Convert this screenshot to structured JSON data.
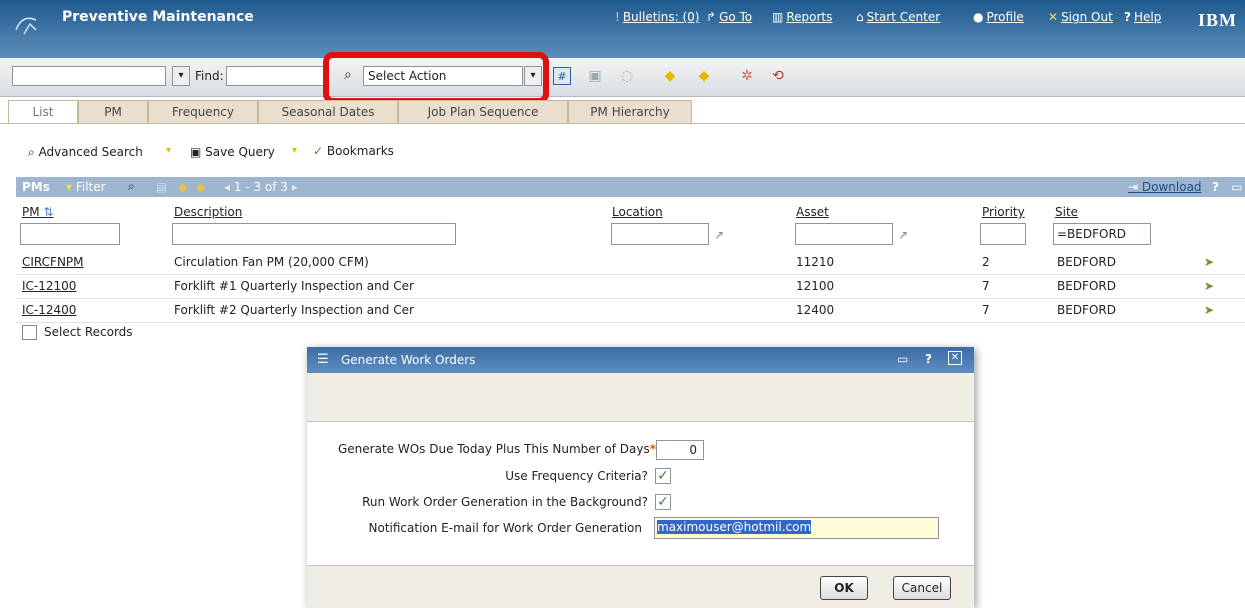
{
  "header": {
    "app_title": "Preventive Maintenance",
    "bulletins": "Bulletins: (0)",
    "goto": "Go To",
    "reports": "Reports",
    "start_center": "Start Center",
    "profile": "Profile",
    "sign_out": "Sign Out",
    "help": "Help",
    "brand": "IBM"
  },
  "toolbar": {
    "find_label": "Find:",
    "select_action": "Select Action"
  },
  "tabs": [
    "List",
    "PM",
    "Frequency",
    "Seasonal Dates",
    "Job Plan Sequence",
    "PM Hierarchy"
  ],
  "listbar": {
    "advanced_search": "Advanced Search",
    "save_query": "Save Query",
    "bookmarks": "Bookmarks"
  },
  "table": {
    "title": "PMs",
    "filter": "Filter",
    "paging": "1 - 3 of 3",
    "download": "Download",
    "columns": [
      "PM",
      "Description",
      "Location",
      "Asset",
      "Priority",
      "Site"
    ],
    "site_filter": "=BEDFORD",
    "rows": [
      {
        "pm": "CIRCFNPM",
        "description": "Circulation Fan PM (20,000 CFM)",
        "location": "",
        "asset": "11210",
        "priority": "2",
        "site": "BEDFORD"
      },
      {
        "pm": "IC-12100",
        "description": "Forklift #1 Quarterly Inspection and Cer",
        "location": "",
        "asset": "12100",
        "priority": "7",
        "site": "BEDFORD"
      },
      {
        "pm": "IC-12400",
        "description": "Forklift #2 Quarterly Inspection and Cer",
        "location": "",
        "asset": "12400",
        "priority": "7",
        "site": "BEDFORD"
      }
    ],
    "select_records": "Select Records"
  },
  "dialog": {
    "title": "Generate Work Orders",
    "days_label": "Generate WOs Due Today Plus This Number of Days",
    "days_value": "0",
    "freq_label": "Use Frequency Criteria?",
    "background_label": "Run Work Order Generation in the Background?",
    "email_label": "Notification E-mail for Work Order Generation",
    "email_value": "maximouser@hotmil.com",
    "ok": "OK",
    "cancel": "Cancel"
  },
  "colors": {
    "header": "#1f5a8f",
    "highlight": "#e01010",
    "table_bar": "#9db5cf",
    "check": "#3a8a2a"
  }
}
